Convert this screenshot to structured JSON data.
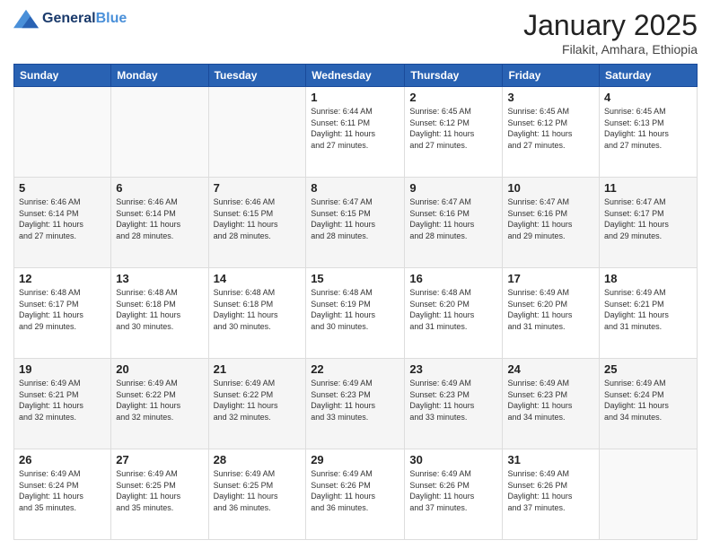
{
  "header": {
    "logo_general": "General",
    "logo_blue": "Blue",
    "month_title": "January 2025",
    "location": "Filakit, Amhara, Ethiopia"
  },
  "days_of_week": [
    "Sunday",
    "Monday",
    "Tuesday",
    "Wednesday",
    "Thursday",
    "Friday",
    "Saturday"
  ],
  "weeks": [
    [
      {
        "day": "",
        "info": ""
      },
      {
        "day": "",
        "info": ""
      },
      {
        "day": "",
        "info": ""
      },
      {
        "day": "1",
        "info": "Sunrise: 6:44 AM\nSunset: 6:11 PM\nDaylight: 11 hours\nand 27 minutes."
      },
      {
        "day": "2",
        "info": "Sunrise: 6:45 AM\nSunset: 6:12 PM\nDaylight: 11 hours\nand 27 minutes."
      },
      {
        "day": "3",
        "info": "Sunrise: 6:45 AM\nSunset: 6:12 PM\nDaylight: 11 hours\nand 27 minutes."
      },
      {
        "day": "4",
        "info": "Sunrise: 6:45 AM\nSunset: 6:13 PM\nDaylight: 11 hours\nand 27 minutes."
      }
    ],
    [
      {
        "day": "5",
        "info": "Sunrise: 6:46 AM\nSunset: 6:14 PM\nDaylight: 11 hours\nand 27 minutes."
      },
      {
        "day": "6",
        "info": "Sunrise: 6:46 AM\nSunset: 6:14 PM\nDaylight: 11 hours\nand 28 minutes."
      },
      {
        "day": "7",
        "info": "Sunrise: 6:46 AM\nSunset: 6:15 PM\nDaylight: 11 hours\nand 28 minutes."
      },
      {
        "day": "8",
        "info": "Sunrise: 6:47 AM\nSunset: 6:15 PM\nDaylight: 11 hours\nand 28 minutes."
      },
      {
        "day": "9",
        "info": "Sunrise: 6:47 AM\nSunset: 6:16 PM\nDaylight: 11 hours\nand 28 minutes."
      },
      {
        "day": "10",
        "info": "Sunrise: 6:47 AM\nSunset: 6:16 PM\nDaylight: 11 hours\nand 29 minutes."
      },
      {
        "day": "11",
        "info": "Sunrise: 6:47 AM\nSunset: 6:17 PM\nDaylight: 11 hours\nand 29 minutes."
      }
    ],
    [
      {
        "day": "12",
        "info": "Sunrise: 6:48 AM\nSunset: 6:17 PM\nDaylight: 11 hours\nand 29 minutes."
      },
      {
        "day": "13",
        "info": "Sunrise: 6:48 AM\nSunset: 6:18 PM\nDaylight: 11 hours\nand 30 minutes."
      },
      {
        "day": "14",
        "info": "Sunrise: 6:48 AM\nSunset: 6:18 PM\nDaylight: 11 hours\nand 30 minutes."
      },
      {
        "day": "15",
        "info": "Sunrise: 6:48 AM\nSunset: 6:19 PM\nDaylight: 11 hours\nand 30 minutes."
      },
      {
        "day": "16",
        "info": "Sunrise: 6:48 AM\nSunset: 6:20 PM\nDaylight: 11 hours\nand 31 minutes."
      },
      {
        "day": "17",
        "info": "Sunrise: 6:49 AM\nSunset: 6:20 PM\nDaylight: 11 hours\nand 31 minutes."
      },
      {
        "day": "18",
        "info": "Sunrise: 6:49 AM\nSunset: 6:21 PM\nDaylight: 11 hours\nand 31 minutes."
      }
    ],
    [
      {
        "day": "19",
        "info": "Sunrise: 6:49 AM\nSunset: 6:21 PM\nDaylight: 11 hours\nand 32 minutes."
      },
      {
        "day": "20",
        "info": "Sunrise: 6:49 AM\nSunset: 6:22 PM\nDaylight: 11 hours\nand 32 minutes."
      },
      {
        "day": "21",
        "info": "Sunrise: 6:49 AM\nSunset: 6:22 PM\nDaylight: 11 hours\nand 32 minutes."
      },
      {
        "day": "22",
        "info": "Sunrise: 6:49 AM\nSunset: 6:23 PM\nDaylight: 11 hours\nand 33 minutes."
      },
      {
        "day": "23",
        "info": "Sunrise: 6:49 AM\nSunset: 6:23 PM\nDaylight: 11 hours\nand 33 minutes."
      },
      {
        "day": "24",
        "info": "Sunrise: 6:49 AM\nSunset: 6:23 PM\nDaylight: 11 hours\nand 34 minutes."
      },
      {
        "day": "25",
        "info": "Sunrise: 6:49 AM\nSunset: 6:24 PM\nDaylight: 11 hours\nand 34 minutes."
      }
    ],
    [
      {
        "day": "26",
        "info": "Sunrise: 6:49 AM\nSunset: 6:24 PM\nDaylight: 11 hours\nand 35 minutes."
      },
      {
        "day": "27",
        "info": "Sunrise: 6:49 AM\nSunset: 6:25 PM\nDaylight: 11 hours\nand 35 minutes."
      },
      {
        "day": "28",
        "info": "Sunrise: 6:49 AM\nSunset: 6:25 PM\nDaylight: 11 hours\nand 36 minutes."
      },
      {
        "day": "29",
        "info": "Sunrise: 6:49 AM\nSunset: 6:26 PM\nDaylight: 11 hours\nand 36 minutes."
      },
      {
        "day": "30",
        "info": "Sunrise: 6:49 AM\nSunset: 6:26 PM\nDaylight: 11 hours\nand 37 minutes."
      },
      {
        "day": "31",
        "info": "Sunrise: 6:49 AM\nSunset: 6:26 PM\nDaylight: 11 hours\nand 37 minutes."
      },
      {
        "day": "",
        "info": ""
      }
    ]
  ]
}
